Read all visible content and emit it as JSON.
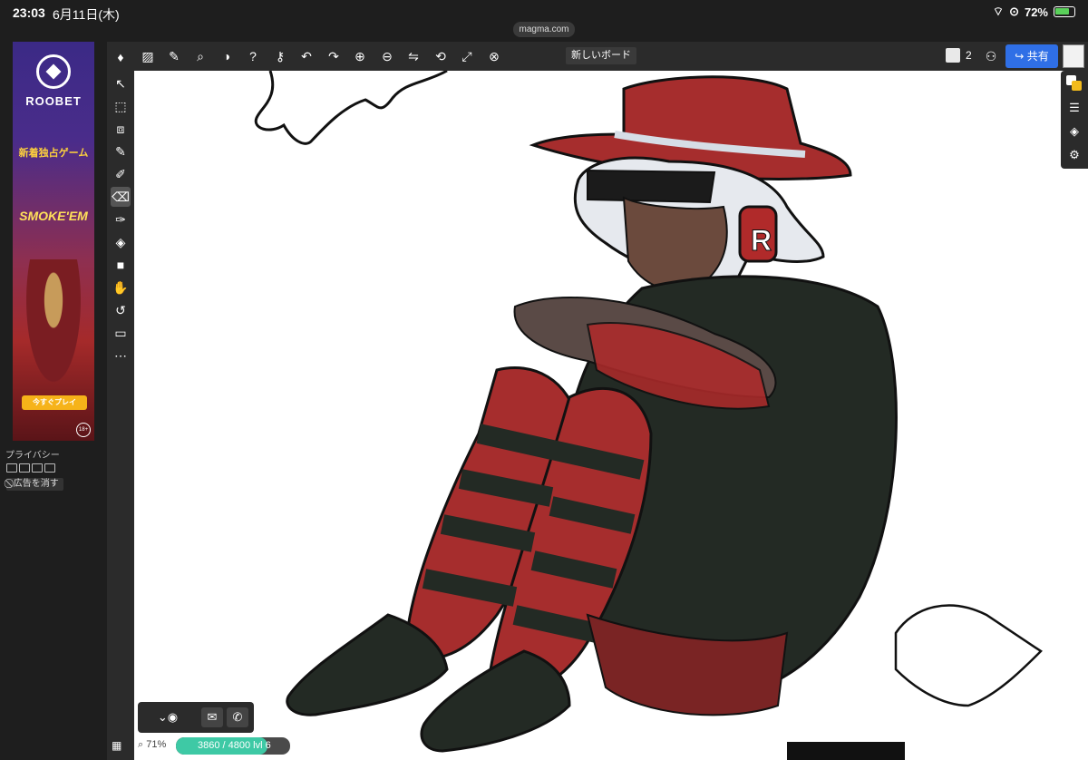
{
  "status": {
    "time": "23:03",
    "date": "6月11日(木)",
    "battery": "72%",
    "url": "magma.com"
  },
  "ad": {
    "brand": "ROOBET",
    "tagline": "新着独占ゲーム",
    "title": "SMOKE'EM",
    "cta": "今すぐプレイ",
    "age": "18+",
    "privacy_label": "プライバシー",
    "remove_ads": "広告を消す"
  },
  "toolbar": {
    "board_name": "新しいボード",
    "user_count": "2",
    "share_label": "共有"
  },
  "tools": [
    {
      "icon": "select-move-icon",
      "glyph": "↖"
    },
    {
      "icon": "marquee-select-icon",
      "glyph": "⬚"
    },
    {
      "icon": "transform-icon",
      "glyph": "◻"
    },
    {
      "icon": "eyedropper-icon",
      "glyph": "✎"
    },
    {
      "icon": "brush-icon",
      "glyph": "🖌"
    },
    {
      "icon": "eraser-icon",
      "glyph": "⌫"
    },
    {
      "icon": "smudge-brush-icon",
      "glyph": "🖌"
    },
    {
      "icon": "paint-bucket-icon",
      "glyph": "◈"
    },
    {
      "icon": "rectangle-icon",
      "glyph": "■"
    },
    {
      "icon": "hand-icon",
      "glyph": "✋"
    },
    {
      "icon": "rotate-icon",
      "glyph": "↺"
    },
    {
      "icon": "comment-icon",
      "glyph": "▭"
    },
    {
      "icon": "more-icon",
      "glyph": "•••"
    }
  ],
  "bottom": {
    "zoom": "71%",
    "progress_text": "3860 / 4800  lvl 6",
    "progress_value": 0.804
  },
  "colors": {
    "accent": "#2f6fe6",
    "progress": "#3ec9a5",
    "primary_color": "#ffffff",
    "secondary_color": "#f3bb1c"
  }
}
